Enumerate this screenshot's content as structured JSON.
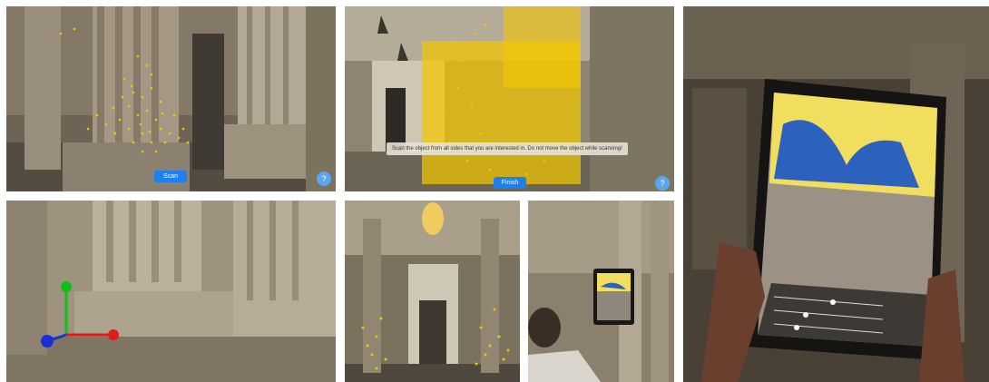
{
  "panel_a": {
    "scan_button": "Scan",
    "help_button": "?"
  },
  "panel_b": {
    "instruction": "Scan the object from all sides that you are interested in. Do not move the object while scanning!",
    "finish_button": "Finish",
    "help_button": "?"
  },
  "colors": {
    "point_cloud": "#f3c600",
    "button": "#1e7ff0",
    "help": "#5aa7ee",
    "axis_x": "#e01919",
    "axis_y": "#10c018",
    "axis_z": "#1b2fd6"
  }
}
